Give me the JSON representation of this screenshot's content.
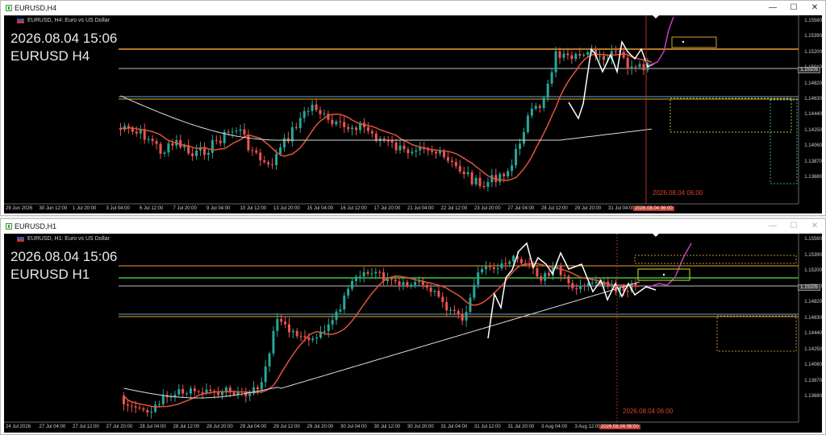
{
  "window1": {
    "title": "EURUSD,H4",
    "symbol_line": "EURUSD, H4:  Euro vs US Dollar",
    "overlay_time": "2026.08.04 15:06",
    "overlay_symbol": "EURUSD H4",
    "vline_label": "2026.08.04 06:00",
    "axis_tag": "2026.08.04 06:00",
    "price_tag": "1.15105",
    "y_labels": [
      "1.15580",
      "1.15390",
      "1.15200",
      "1.15010",
      "1.14820",
      "1.14630",
      "1.14440",
      "1.14250",
      "1.14060",
      "1.13870",
      "1.13680"
    ],
    "x_labels": [
      "29 Jun 2026",
      "30 Jun 12:00",
      "1 Jul 20:00",
      "3 Jul 04:00",
      "6 Jul 12:00",
      "7 Jul 20:00",
      "9 Jul 04:00",
      "10 Jul 12:00",
      "13 Jul 20:00",
      "15 Jul 04:00",
      "16 Jul 12:00",
      "17 Jul 20:00",
      "21 Jul 04:00",
      "22 Jul 12:00",
      "23 Jul 20:00",
      "27 Jul 04:00",
      "28 Jul 12:00",
      "29 Jul 20:00",
      "31 Jul 04:00"
    ]
  },
  "window2": {
    "title": "EURUSD,H1",
    "symbol_line": "EURUSD, H1:  Euro vs US Dollar",
    "overlay_time": "2026.08.04 15:06",
    "overlay_symbol": "EURUSD H1",
    "vline_label": "2026.08.04 06:00",
    "axis_tag": "2026.08.04 06:00",
    "price_tag": "1.15105",
    "y_labels": [
      "1.15580",
      "1.15390",
      "1.15200",
      "1.15010",
      "1.14820",
      "1.14630",
      "1.14440",
      "1.14250",
      "1.14060",
      "1.13870",
      "1.13680"
    ],
    "x_labels": [
      "24 Jul 2026",
      "27 Jul 04:00",
      "27 Jul 12:00",
      "27 Jul 20:00",
      "28 Jul 04:00",
      "28 Jul 12:00",
      "28 Jul 20:00",
      "29 Jul 04:00",
      "29 Jul 12:00",
      "29 Jul 20:00",
      "30 Jul 04:00",
      "30 Jul 12:00",
      "30 Jul 20:00",
      "31 Jul 04:00",
      "31 Jul 12:00",
      "31 Jul 20:00",
      "3 Aug 04:00",
      "3 Aug 12:00",
      "4 Aug 04:00"
    ]
  },
  "controls": {
    "minimize": "—",
    "maximize": "☐",
    "close": "✕"
  },
  "colors": {
    "bull": "#26a69a",
    "bear": "#ef5350",
    "ma_fast": "#e0553b",
    "ma_slow": "#dddddd",
    "zigzag": "#ffffff",
    "forecast": "#c040c0",
    "level_orange": "#f0a030",
    "level_blue": "#5fb0d0",
    "level_green": "#40c040"
  }
}
